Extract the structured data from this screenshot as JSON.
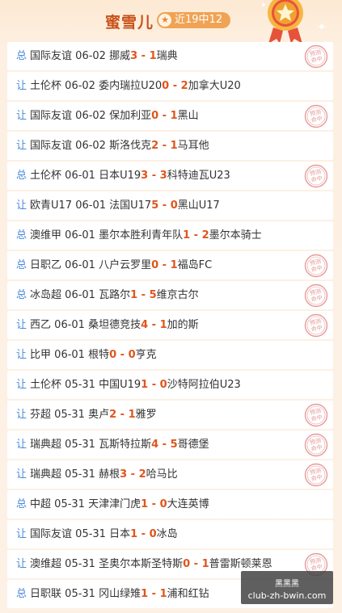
{
  "header": {
    "title": "蜜雪儿",
    "record": "近19中12"
  },
  "stamp_text": "预测命中",
  "matches": [
    {
      "type": "总",
      "league": "国际友谊",
      "date": "06-02",
      "home": "挪威",
      "hs": "3",
      "sep": " - ",
      "as": "1",
      "away": "瑞典",
      "hit": true
    },
    {
      "type": "让",
      "league": "土伦杯",
      "date": "06-02",
      "home": "委内瑞拉U20",
      "hs": "0",
      "sep": " - ",
      "as": "2",
      "away": "加拿大U20",
      "hit": false
    },
    {
      "type": "让",
      "league": "国际友谊",
      "date": "06-02",
      "home": "保加利亚",
      "hs": "0",
      "sep": " - ",
      "as": "1",
      "away": "黑山",
      "hit": true
    },
    {
      "type": "让",
      "league": "国际友谊",
      "date": "06-02",
      "home": "斯洛伐克",
      "hs": "2",
      "sep": " - ",
      "as": "1",
      "away": "马耳他",
      "hit": false
    },
    {
      "type": "总",
      "league": "土伦杯",
      "date": "06-01",
      "home": "日本U19",
      "hs": "3",
      "sep": " - ",
      "as": "3",
      "away": "科特迪瓦U23",
      "hit": true
    },
    {
      "type": "让",
      "league": "欧青U17",
      "date": "06-01",
      "home": "法国U17",
      "hs": "5",
      "sep": " - ",
      "as": "0",
      "away": "黑山U17",
      "hit": false
    },
    {
      "type": "总",
      "league": "澳维甲",
      "date": "06-01",
      "home": "墨尔本胜利青年队",
      "hs": "1",
      "sep": " - ",
      "as": "2",
      "away": "墨尔本骑士",
      "hit": false
    },
    {
      "type": "总",
      "league": "日职乙",
      "date": "06-01",
      "home": "八户云罗里",
      "hs": "0",
      "sep": " - ",
      "as": "1",
      "away": "福岛FC",
      "hit": true
    },
    {
      "type": "总",
      "league": "冰岛超",
      "date": "06-01",
      "home": "瓦路尔",
      "hs": "1",
      "sep": " - ",
      "as": "5",
      "away": "维京古尔",
      "hit": true
    },
    {
      "type": "让",
      "league": "西乙",
      "date": "06-01",
      "home": "桑坦德竞技",
      "hs": "4",
      "sep": " - ",
      "as": "1",
      "away": "加的斯",
      "hit": true
    },
    {
      "type": "让",
      "league": "比甲",
      "date": "06-01",
      "home": "根特",
      "hs": "0",
      "sep": " - ",
      "as": "0",
      "away": "亨克",
      "hit": false
    },
    {
      "type": "让",
      "league": "土伦杯",
      "date": "05-31",
      "home": "中国U19",
      "hs": "1",
      "sep": " - ",
      "as": "0",
      "away": "沙特阿拉伯U23",
      "hit": false
    },
    {
      "type": "让",
      "league": "芬超",
      "date": "05-31",
      "home": "奥卢",
      "hs": "2",
      "sep": " - ",
      "as": "1",
      "away": "雅罗",
      "hit": true
    },
    {
      "type": "让",
      "league": "瑞典超",
      "date": "05-31",
      "home": "瓦斯特拉斯",
      "hs": "4",
      "sep": " - ",
      "as": "5",
      "away": "哥德堡",
      "hit": true
    },
    {
      "type": "让",
      "league": "瑞典超",
      "date": "05-31",
      "home": "赫根",
      "hs": "3",
      "sep": " - ",
      "as": "2",
      "away": "哈马比",
      "hit": true
    },
    {
      "type": "总",
      "league": "中超",
      "date": "05-31",
      "home": "天津津门虎",
      "hs": "1",
      "sep": " - ",
      "as": "0",
      "away": "大连英博",
      "hit": false
    },
    {
      "type": "让",
      "league": "国际友谊",
      "date": "05-31",
      "home": "日本",
      "hs": "1",
      "sep": " - ",
      "as": "0",
      "away": "冰岛",
      "hit": false
    },
    {
      "type": "让",
      "league": "澳维超",
      "date": "05-31",
      "home": "圣奥尔本斯圣特斯",
      "hs": "0",
      "sep": " - ",
      "as": "1",
      "away": "普雷斯顿莱恩",
      "hit": true
    },
    {
      "type": "总",
      "league": "日职联",
      "date": "05-31",
      "home": "冈山绿雉",
      "hs": "1",
      "sep": " - ",
      "as": "1",
      "away": "浦和红钻",
      "hit": false
    }
  ],
  "watermark": {
    "line1": "黑黑黑",
    "line2": "club-zh-bwin.com"
  },
  "colors": {
    "type": "#4a8ad8",
    "score": "#e0551c",
    "title": "#c8521a",
    "badge": "#f0a354",
    "stamp": "#e89a9a"
  }
}
